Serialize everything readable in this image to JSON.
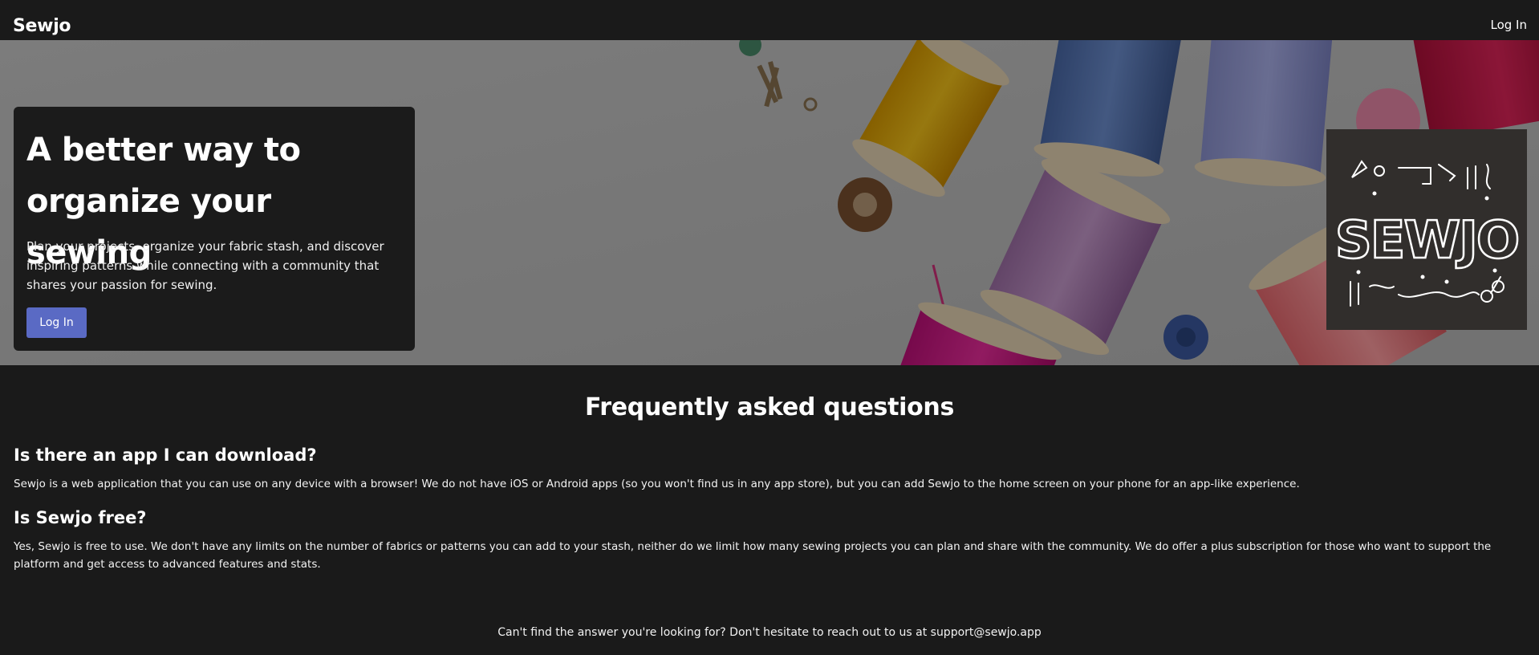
{
  "header": {
    "brand": "Sewjo",
    "login_label": "Log In"
  },
  "hero": {
    "title": "A better way to organize your sewing",
    "description": "Plan your projects, organize your fabric stash, and discover inspiring patterns while connecting with a community that shares your passion for sewing.",
    "cta_label": "Log In",
    "logo_text": "SEWJO"
  },
  "faq": {
    "title": "Frequently asked questions",
    "items": [
      {
        "question": "Is there an app I can download?",
        "answer": "Sewjo is a web application that you can use on any device with a browser! We do not have iOS or Android apps (so you won't find us in any app store), but you can add Sewjo to the home screen on your phone for an app-like experience."
      },
      {
        "question": "Is Sewjo free?",
        "answer": "Yes, Sewjo is free to use. We don't have any limits on the number of fabrics or patterns you can add to your stash, neither do we limit how many sewing projects you can plan and share with the community. We do offer a plus subscription for those who want to support the platform and get access to advanced features and stats."
      }
    ]
  },
  "footer": {
    "note": "Can't find the answer you're looking for? Don't hesitate to reach out to us at support@sewjo.app"
  },
  "colors": {
    "background": "#1a1a1a",
    "card": "#1b1b1b",
    "accent": "#5a6ac4"
  }
}
